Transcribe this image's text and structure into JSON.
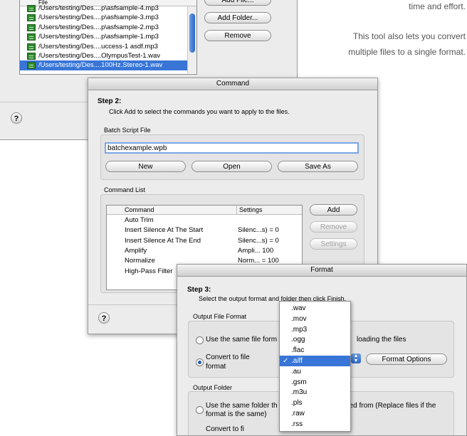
{
  "marketing": {
    "line1": "time and effort.",
    "line2": "This tool also lets you convert",
    "line3": "multiple files to a single format."
  },
  "files_window": {
    "column_header": "File",
    "files": [
      "/Users/testing/Des....p\\asfsample-4.mp3",
      "/Users/testing/Des....p\\asfsample-3.mp3",
      "/Users/testing/Des....p\\asfsample-2.mp3",
      "/Users/testing/Des....p\\asfsample-1.mp3",
      "/Users/testing/Des....uccess-1  asdf.mp3",
      "/Users/testing/Des....OlympusTest-1.wav",
      "/Users/testing/Des....100Hz.Stereo-1.wav"
    ],
    "selected_index": 6,
    "add_file": "Add File...",
    "add_folder": "Add Folder...",
    "remove": "Remove",
    "help": "?"
  },
  "command_window": {
    "title": "Command",
    "step_title": "Step 2:",
    "step_desc": "Click Add to select the commands you want to apply to the files.",
    "batch_label": "Batch Script File",
    "batch_value": "batchexample.wpb",
    "new": "New",
    "open": "Open",
    "save_as": "Save As",
    "command_list_label": "Command List",
    "col_command": "Command",
    "col_settings": "Settings",
    "commands": [
      {
        "name": "Auto Trim",
        "settings": ""
      },
      {
        "name": "Insert Silence At The Start",
        "settings": "Silenc...s) = 0"
      },
      {
        "name": "Insert Silence At The End",
        "settings": "Silenc...s) = 0"
      },
      {
        "name": "Amplify",
        "settings": "Ampli... 100"
      },
      {
        "name": "Normalize",
        "settings": "Norm... = 100"
      },
      {
        "name": "High-Pass Filter",
        "settings": ""
      }
    ],
    "add": "Add",
    "remove": "Remove",
    "settings": "Settings",
    "help": "?"
  },
  "format_window": {
    "title": "Format",
    "step_title": "Step 3:",
    "step_desc": "Select the output format and folder then click Finish.",
    "output_format_label": "Output File Format",
    "same_format": "Use the same file form",
    "same_format_tail": "loading the files",
    "convert_line1": "Convert to file",
    "convert_line2": "format",
    "format_options": "Format Options",
    "output_folder_label": "Output Folder",
    "same_folder_a": "Use the same folder th",
    "same_folder_b": "ded from (Replace files if the",
    "same_folder_c": "format is the same)",
    "convert_to_partial": "Convert to fi",
    "help": "?"
  },
  "format_menu": {
    "options": [
      ".wav",
      ".mov",
      ".mp3",
      ".ogg",
      ".flac",
      ".aiff",
      ".au",
      ".gsm",
      ".m3u",
      ".pls",
      ".raw",
      ".rss"
    ],
    "selected": ".aiff",
    "selected_index": 5,
    "check": "✓"
  }
}
